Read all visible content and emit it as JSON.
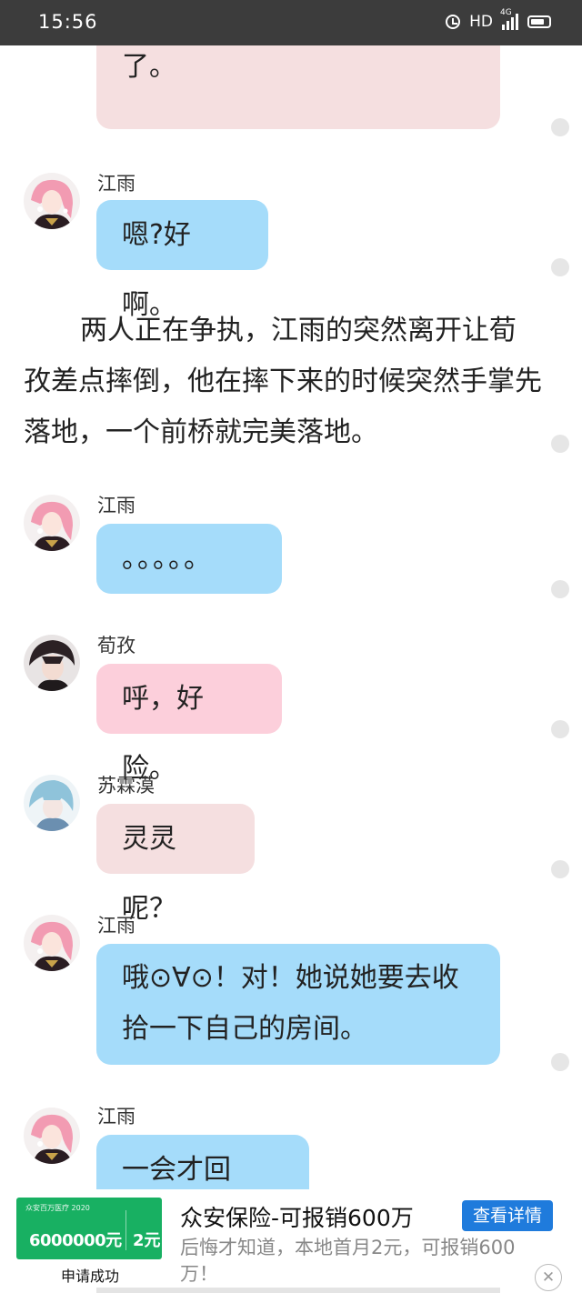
{
  "status": {
    "time": "15:56",
    "hd": "HD",
    "net": "4G"
  },
  "messages": [
    {
      "text": "了。"
    },
    {
      "name": "江雨",
      "text": "嗯?好啊。"
    },
    {
      "narration": "两人正在争执，江雨的突然离开让荀孜差点摔倒，他在摔下来的时候突然手掌先落地，一个前桥就完美落地。"
    },
    {
      "name": "江雨",
      "text": "。。。。。"
    },
    {
      "name": "荀孜",
      "text": "呼，好险。"
    },
    {
      "name": "苏霖漠",
      "text": "灵灵呢？"
    },
    {
      "name": "江雨",
      "text": "哦⊙∀⊙！对！她说她要去收拾一下自己的房间。"
    },
    {
      "name": "江雨",
      "text": "一会才回来。"
    }
  ],
  "ad": {
    "image_small_text": "众安百万医疗 2020",
    "image_amount": "6000000元",
    "image_price": "2元",
    "image_caption": "申请成功",
    "title": "众安保险-可报销600万",
    "button": "查看详情",
    "description": "后悔才知道，本地首月2元，可报销600万！"
  },
  "colors": {
    "statusbar": "#3c3c3c",
    "bubble_jiangyu": "#a5dcfa",
    "bubble_xunzi": "#fccfdb",
    "bubble_sulinmo": "#f5dfe0",
    "ad_green": "#18b062",
    "ad_button": "#1f7bdc"
  },
  "icons": [
    "alarm-icon",
    "signal-icon",
    "battery-icon",
    "close-icon"
  ]
}
